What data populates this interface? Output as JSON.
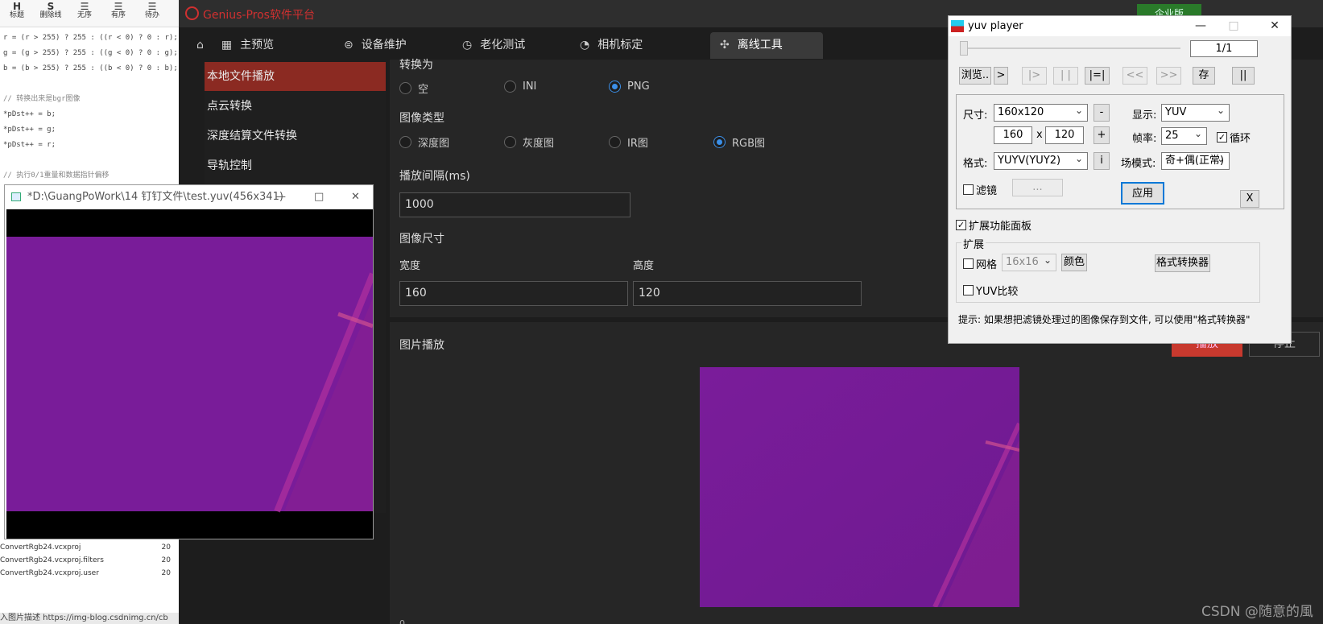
{
  "editor": {
    "toolbar": [
      {
        "icon": "H",
        "label": "标题"
      },
      {
        "icon": "S",
        "label": "删除线"
      },
      {
        "icon": "☰",
        "label": "无序"
      },
      {
        "icon": "☰",
        "label": "有序"
      },
      {
        "icon": "☰",
        "label": "待办"
      }
    ],
    "code_lines": [
      {
        "text": "r = (r > 255) ? 255 : ((r < 0) ? 0 : r);",
        "kind": "code"
      },
      {
        "text": "g = (g > 255) ? 255 : ((g < 0) ? 0 : g);",
        "kind": "code"
      },
      {
        "text": "b = (b > 255) ? 255 : ((b < 0) ? 0 : b);",
        "kind": "code"
      },
      {
        "text": "",
        "kind": "code"
      },
      {
        "text": "// 转换出来是bgr图像",
        "kind": "cmt"
      },
      {
        "text": "*pDst++ = b;",
        "kind": "code"
      },
      {
        "text": "*pDst++ = g;",
        "kind": "code"
      },
      {
        "text": "*pDst++ = r;",
        "kind": "code"
      },
      {
        "text": "",
        "kind": "code"
      },
      {
        "text": "// 执行0/1重量和数据指针偏移",
        "kind": "cmt"
      }
    ],
    "files": [
      {
        "name": "ConvertRgb24.vcxproj",
        "num": "20"
      },
      {
        "name": "ConvertRgb24.vcxproj.filters",
        "num": "20"
      },
      {
        "name": "ConvertRgb24.vcxproj.user",
        "num": "20"
      }
    ],
    "status_text": "入图片描述 https://img-blog.csdnimg.cn/cb"
  },
  "app": {
    "title": "Genius-Pros软件平台",
    "edition": "企业版",
    "tabs": [
      "主预览",
      "设备维护",
      "老化测试",
      "相机标定",
      "离线工具"
    ],
    "tab_icons": [
      "home-icon",
      "grid-icon",
      "wrench-icon",
      "clock-icon",
      "gauge-icon",
      "tools-icon"
    ],
    "active_tab": "离线工具",
    "sidebar": [
      "本地文件播放",
      "点云转换",
      "深度结算文件转换",
      "导轨控制"
    ],
    "convert_label": "转换为",
    "convert_options": [
      "空",
      "INI",
      "PNG"
    ],
    "convert_selected": "PNG",
    "image_type_label": "图像类型",
    "image_type_options": [
      "深度图",
      "灰度图",
      "IR图",
      "RGB图"
    ],
    "image_type_selected": "RGB图",
    "interval_label": "播放间隔(ms)",
    "interval_value": "1000",
    "size_label": "图像尺寸",
    "width_label": "宽度",
    "width_value": "160",
    "height_label": "高度",
    "height_value": "120",
    "playback_label": "图片播放",
    "play_button": "播放",
    "stop_button": "停止",
    "footer_char": "0",
    "watermark": "CSDN @随意的風",
    "colors": {
      "accent_red": "#c8392e",
      "selected_side": "#8b2a22",
      "radio_blue": "#3b8fe8",
      "image_purple": "#7a1c9a"
    }
  },
  "viewer": {
    "title": "*D:\\GuangPoWork\\14 钉钉文件\\test.yuv(456x341)",
    "controls": [
      "—",
      "□",
      "✕"
    ]
  },
  "yuv_player": {
    "title": "yuv player",
    "frame_counter": "1/1",
    "browse": "浏览..",
    "play_next": ">",
    "nav_buttons": [
      "|>",
      "| |",
      "|=|",
      "<<",
      ">>"
    ],
    "save": "存",
    "pause": "||",
    "size_label": "尺寸:",
    "size_value": "160x120",
    "minus": "-",
    "plus": "+",
    "width": "160",
    "times": "x",
    "height": "120",
    "display_label": "显示:",
    "display_value": "YUV",
    "fps_label": "帧率:",
    "fps_value": "25",
    "loop_label": "循环",
    "loop_checked": true,
    "format_label": "格式:",
    "format_value": "YUYV(YUY2)",
    "info_btn": "i",
    "field_label": "场模式:",
    "field_value": "奇+偶(正常)",
    "filter_label": "滤镜",
    "filter_more": "...",
    "apply": "应用",
    "close_x": "X",
    "extend_panel_label": "扩展功能面板",
    "extend_group": "扩展",
    "grid_label": "网格",
    "grid_value": "16x16",
    "color_btn": "颜色",
    "converter_btn": "格式转换器",
    "yuv_compare": "YUV比较",
    "hint": "提示: 如果想把滤镜处理过的图像保存到文件, 可以使用\"格式转换器\""
  }
}
